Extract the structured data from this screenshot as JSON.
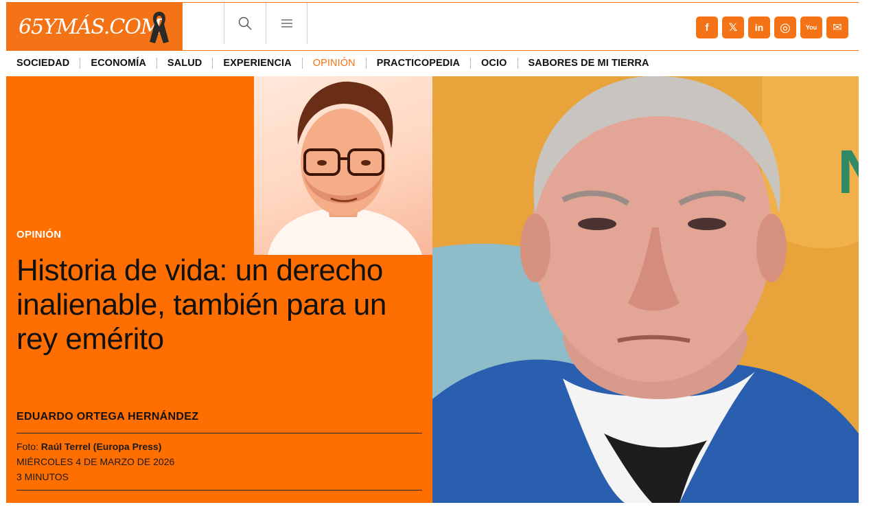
{
  "brand": {
    "logo_text": "65YMÁS.COM",
    "accent": "#f47316"
  },
  "header": {
    "search_icon": "search-icon",
    "menu_icon": "hamburger-menu-icon",
    "social": [
      {
        "name": "facebook-icon",
        "glyph": "f"
      },
      {
        "name": "x-icon",
        "glyph": "𝕏"
      },
      {
        "name": "linkedin-icon",
        "glyph": "in"
      },
      {
        "name": "instagram-icon",
        "glyph": "◎"
      },
      {
        "name": "youtube-icon",
        "glyph": "You"
      },
      {
        "name": "email-icon",
        "glyph": "✉"
      }
    ]
  },
  "nav": {
    "items": [
      {
        "label": "SOCIEDAD",
        "active": false
      },
      {
        "label": "ECONOMÍA",
        "active": false
      },
      {
        "label": "SALUD",
        "active": false
      },
      {
        "label": "EXPERIENCIA",
        "active": false
      },
      {
        "label": "OPINIÓN",
        "active": true
      },
      {
        "label": "PRACTICOPEDIA",
        "active": false
      },
      {
        "label": "OCIO",
        "active": false
      },
      {
        "label": "SABORES DE MI TIERRA",
        "active": false
      }
    ]
  },
  "article": {
    "section": "OPINIÓN",
    "title": "Historia de vida: un derecho inalienable, también para un rey emérito",
    "author": "EDUARDO ORTEGA HERNÁNDEZ",
    "photo_label": "Foto:",
    "photo_credit": "Raúl Terrel (Europa Press)",
    "date": "MIÉRCOLES 4 DE MARZO DE 2026",
    "reading_time": "3 MINUTOS"
  }
}
